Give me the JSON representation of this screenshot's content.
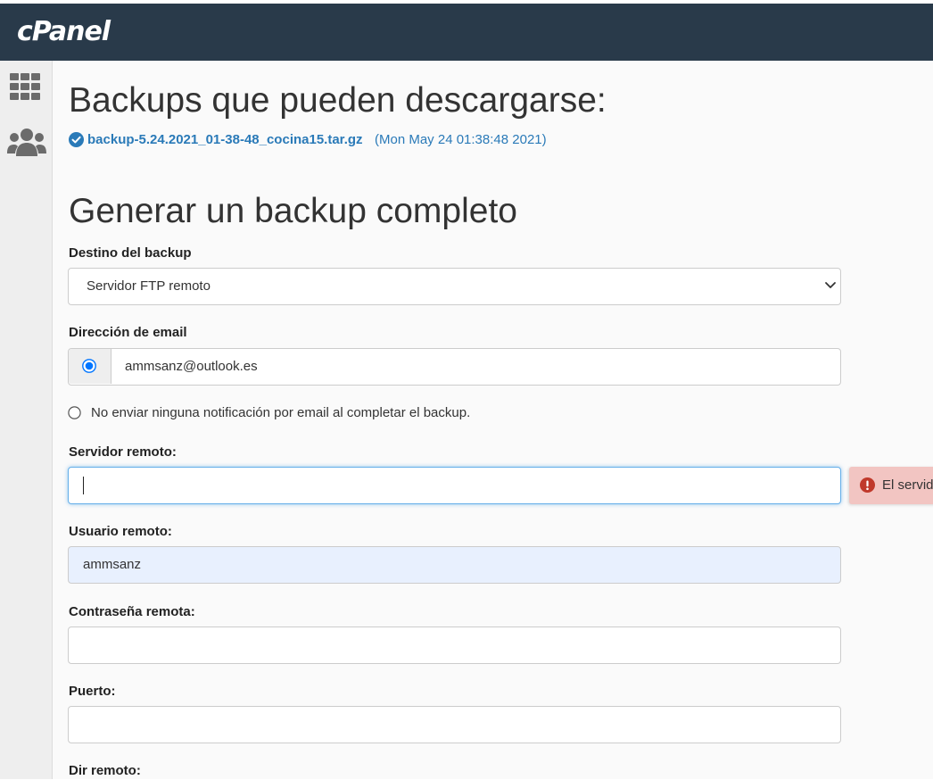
{
  "app": {
    "logo": "cPanel"
  },
  "sidebar": {
    "icons": [
      "grid-icon",
      "users-icon"
    ]
  },
  "downloads": {
    "title": "Backups que pueden descargarse:",
    "backup_file": "backup-5.24.2021_01-38-48_cocina15.tar.gz",
    "backup_date": "(Mon May 24 01:38:48 2021)"
  },
  "form": {
    "title": "Generar un backup completo",
    "destination": {
      "label": "Destino del backup",
      "value": "Servidor FTP remoto"
    },
    "email": {
      "label": "Dirección de email",
      "value": "ammsanz@outlook.es"
    },
    "no_notify": {
      "label": "No enviar ninguna notificación por email al completar el backup."
    },
    "remote_server": {
      "label": "Servidor remoto:",
      "value": "",
      "error": "El servidor"
    },
    "remote_user": {
      "label": "Usuario remoto:",
      "value": "ammsanz"
    },
    "remote_password": {
      "label": "Contraseña remota:",
      "value": ""
    },
    "port": {
      "label": "Puerto:",
      "value": ""
    },
    "remote_dir": {
      "label": "Dir remoto:"
    }
  },
  "colors": {
    "topbar": "#293a4a",
    "link": "#2a7ab8",
    "error_bg": "#f2c5c2",
    "error_icon": "#c0392b",
    "focus_border": "#66afe9",
    "autofill_bg": "#e8f0fe"
  }
}
